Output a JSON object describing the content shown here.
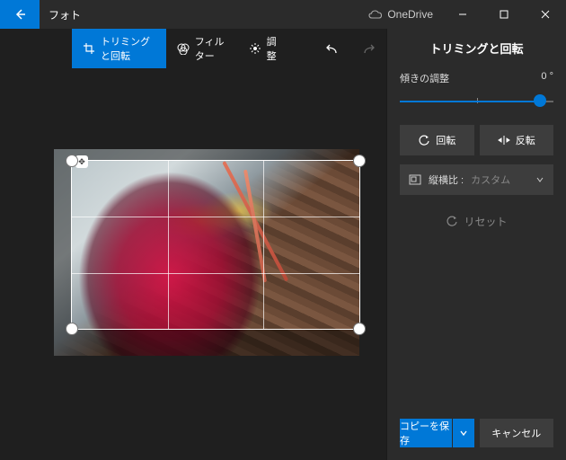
{
  "window": {
    "title": "フォト",
    "cloud_service": "OneDrive"
  },
  "toolbar": {
    "crop_rotate": "トリミングと回転",
    "filter": "フィルター",
    "adjust": "調整"
  },
  "sidebar": {
    "title": "トリミングと回転",
    "tilt_label": "傾きの調整",
    "tilt_value": "0 °",
    "rotate_label": "回転",
    "flip_label": "反転",
    "aspect_label": "縦横比 :",
    "aspect_value": "カスタム",
    "reset_label": "リセット"
  },
  "footer": {
    "save_copy": "コピーを保存",
    "cancel": "キャンセル"
  }
}
